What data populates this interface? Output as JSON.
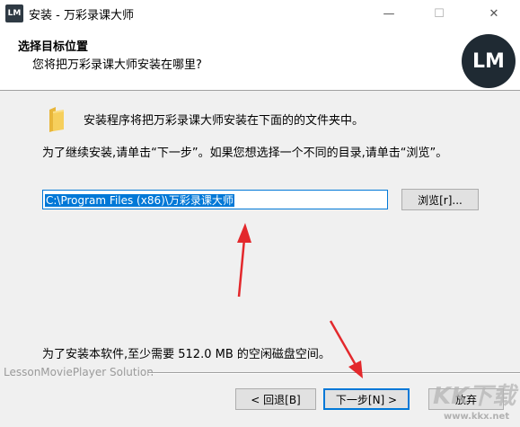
{
  "window": {
    "app_icon_text": "LM",
    "title": "安装 - 万彩录课大师",
    "minimize_glyph": "—",
    "maximize_glyph": "☐",
    "close_glyph": "✕"
  },
  "header": {
    "title": "选择目标位置",
    "subtitle": "您将把万彩录课大师安装在哪里?",
    "logo_text": "LM"
  },
  "body": {
    "folder_icon": "folder-icon",
    "folder_label": "安装程序将把万彩录课大师安装在下面的的文件夹中。",
    "instruction": "为了继续安装,请单击“下一步”。如果您想选择一个不同的目录,请单击“浏览”。",
    "path_value": "C:\\Program Files (x86)\\万彩录课大师",
    "browse_label": "浏览[r]...",
    "space_required": "为了安装本软件,至少需要 512.0 MB 的空闲磁盘空间。"
  },
  "footer": {
    "brand": "LessonMoviePlayer Solution",
    "back_label": "< 回退[B]",
    "next_label": "下一步[N] >",
    "cancel_label": "放弃"
  },
  "watermark": {
    "big": "KK下载",
    "small": "www.kkx.net"
  },
  "colors": {
    "accent": "#0078d7",
    "annotation_arrow": "#e3282c",
    "logo_bg": "#1f2a33"
  }
}
